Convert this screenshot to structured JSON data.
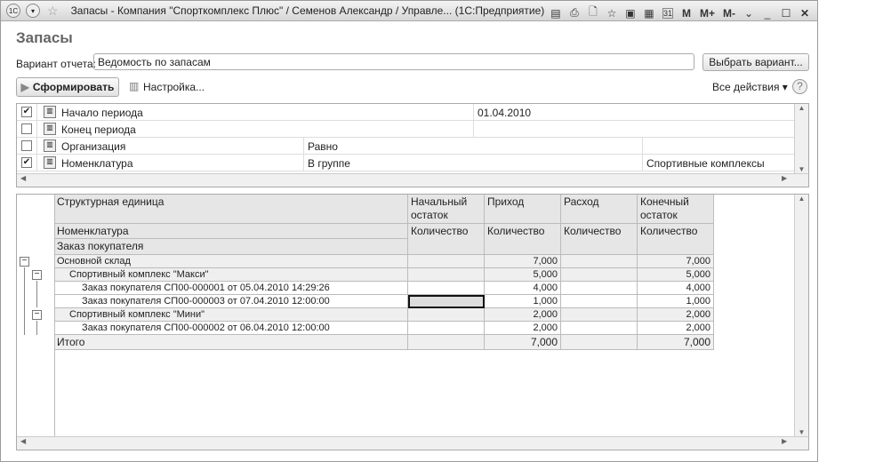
{
  "window": {
    "title": "Запасы - Компания \"Спорткомплекс Плюс\" / Семенов Александр / Управле... (1С:Предприятие)",
    "logo": "1С",
    "tools": [
      "save-icon",
      "print-icon",
      "preview-icon",
      "favorite-icon",
      "favorites-icon",
      "calculator-icon",
      "calendar-icon"
    ],
    "calendar_day": "31",
    "mem": [
      "M",
      "M+",
      "M-"
    ]
  },
  "form": {
    "title": "Запасы",
    "variant_label": "Вариант отчета:",
    "variant_value": "Ведомость по запасам",
    "choose_variant": "Выбрать вариант...",
    "generate": "Сформировать",
    "settings": "Настройка...",
    "all_actions": "Все действия",
    "help": "?"
  },
  "filters": [
    {
      "checked": true,
      "mark": "✔",
      "name": "Начало периода",
      "cond": "",
      "value": "01.04.2010"
    },
    {
      "checked": false,
      "mark": "",
      "name": "Конец периода",
      "cond": "",
      "value": ""
    },
    {
      "checked": false,
      "mark": "",
      "name": "Организация",
      "cond": "Равно",
      "value": ""
    },
    {
      "checked": true,
      "mark": "✔",
      "name": "Номенклатура",
      "cond": "В группе",
      "value": "Спортивные комплексы"
    }
  ],
  "report": {
    "headers": {
      "c1a": "Структурная единица",
      "c1b": "Номенклатура",
      "c1c": "Заказ покупателя",
      "c2": "Начальный остаток",
      "c3": "Приход",
      "c4": "Расход",
      "c5": "Конечный остаток",
      "qty": "Количество"
    },
    "rows": [
      {
        "name": "Основной склад",
        "level": 0,
        "start": "",
        "in": "7,000",
        "out": "",
        "end": "7,000"
      },
      {
        "name": "Спортивный комплекс \"Макси\"",
        "level": 1,
        "start": "",
        "in": "5,000",
        "out": "",
        "end": "5,000"
      },
      {
        "name": "Заказ покупателя СП00-000001 от 05.04.2010 14:29:26",
        "level": 2,
        "start": "",
        "in": "4,000",
        "out": "",
        "end": "4,000"
      },
      {
        "name": "Заказ покупателя СП00-000003 от 07.04.2010 12:00:00",
        "level": 2,
        "start": "",
        "in": "1,000",
        "out": "",
        "end": "1,000"
      },
      {
        "name": "Спортивный комплекс \"Мини\"",
        "level": 1,
        "start": "",
        "in": "2,000",
        "out": "",
        "end": "2,000"
      },
      {
        "name": "Заказ покупателя СП00-000002 от 06.04.2010 12:00:00",
        "level": 2,
        "start": "",
        "in": "2,000",
        "out": "",
        "end": "2,000"
      }
    ],
    "total": {
      "name": "Итого",
      "start": "",
      "in": "7,000",
      "out": "",
      "end": "7,000"
    }
  }
}
